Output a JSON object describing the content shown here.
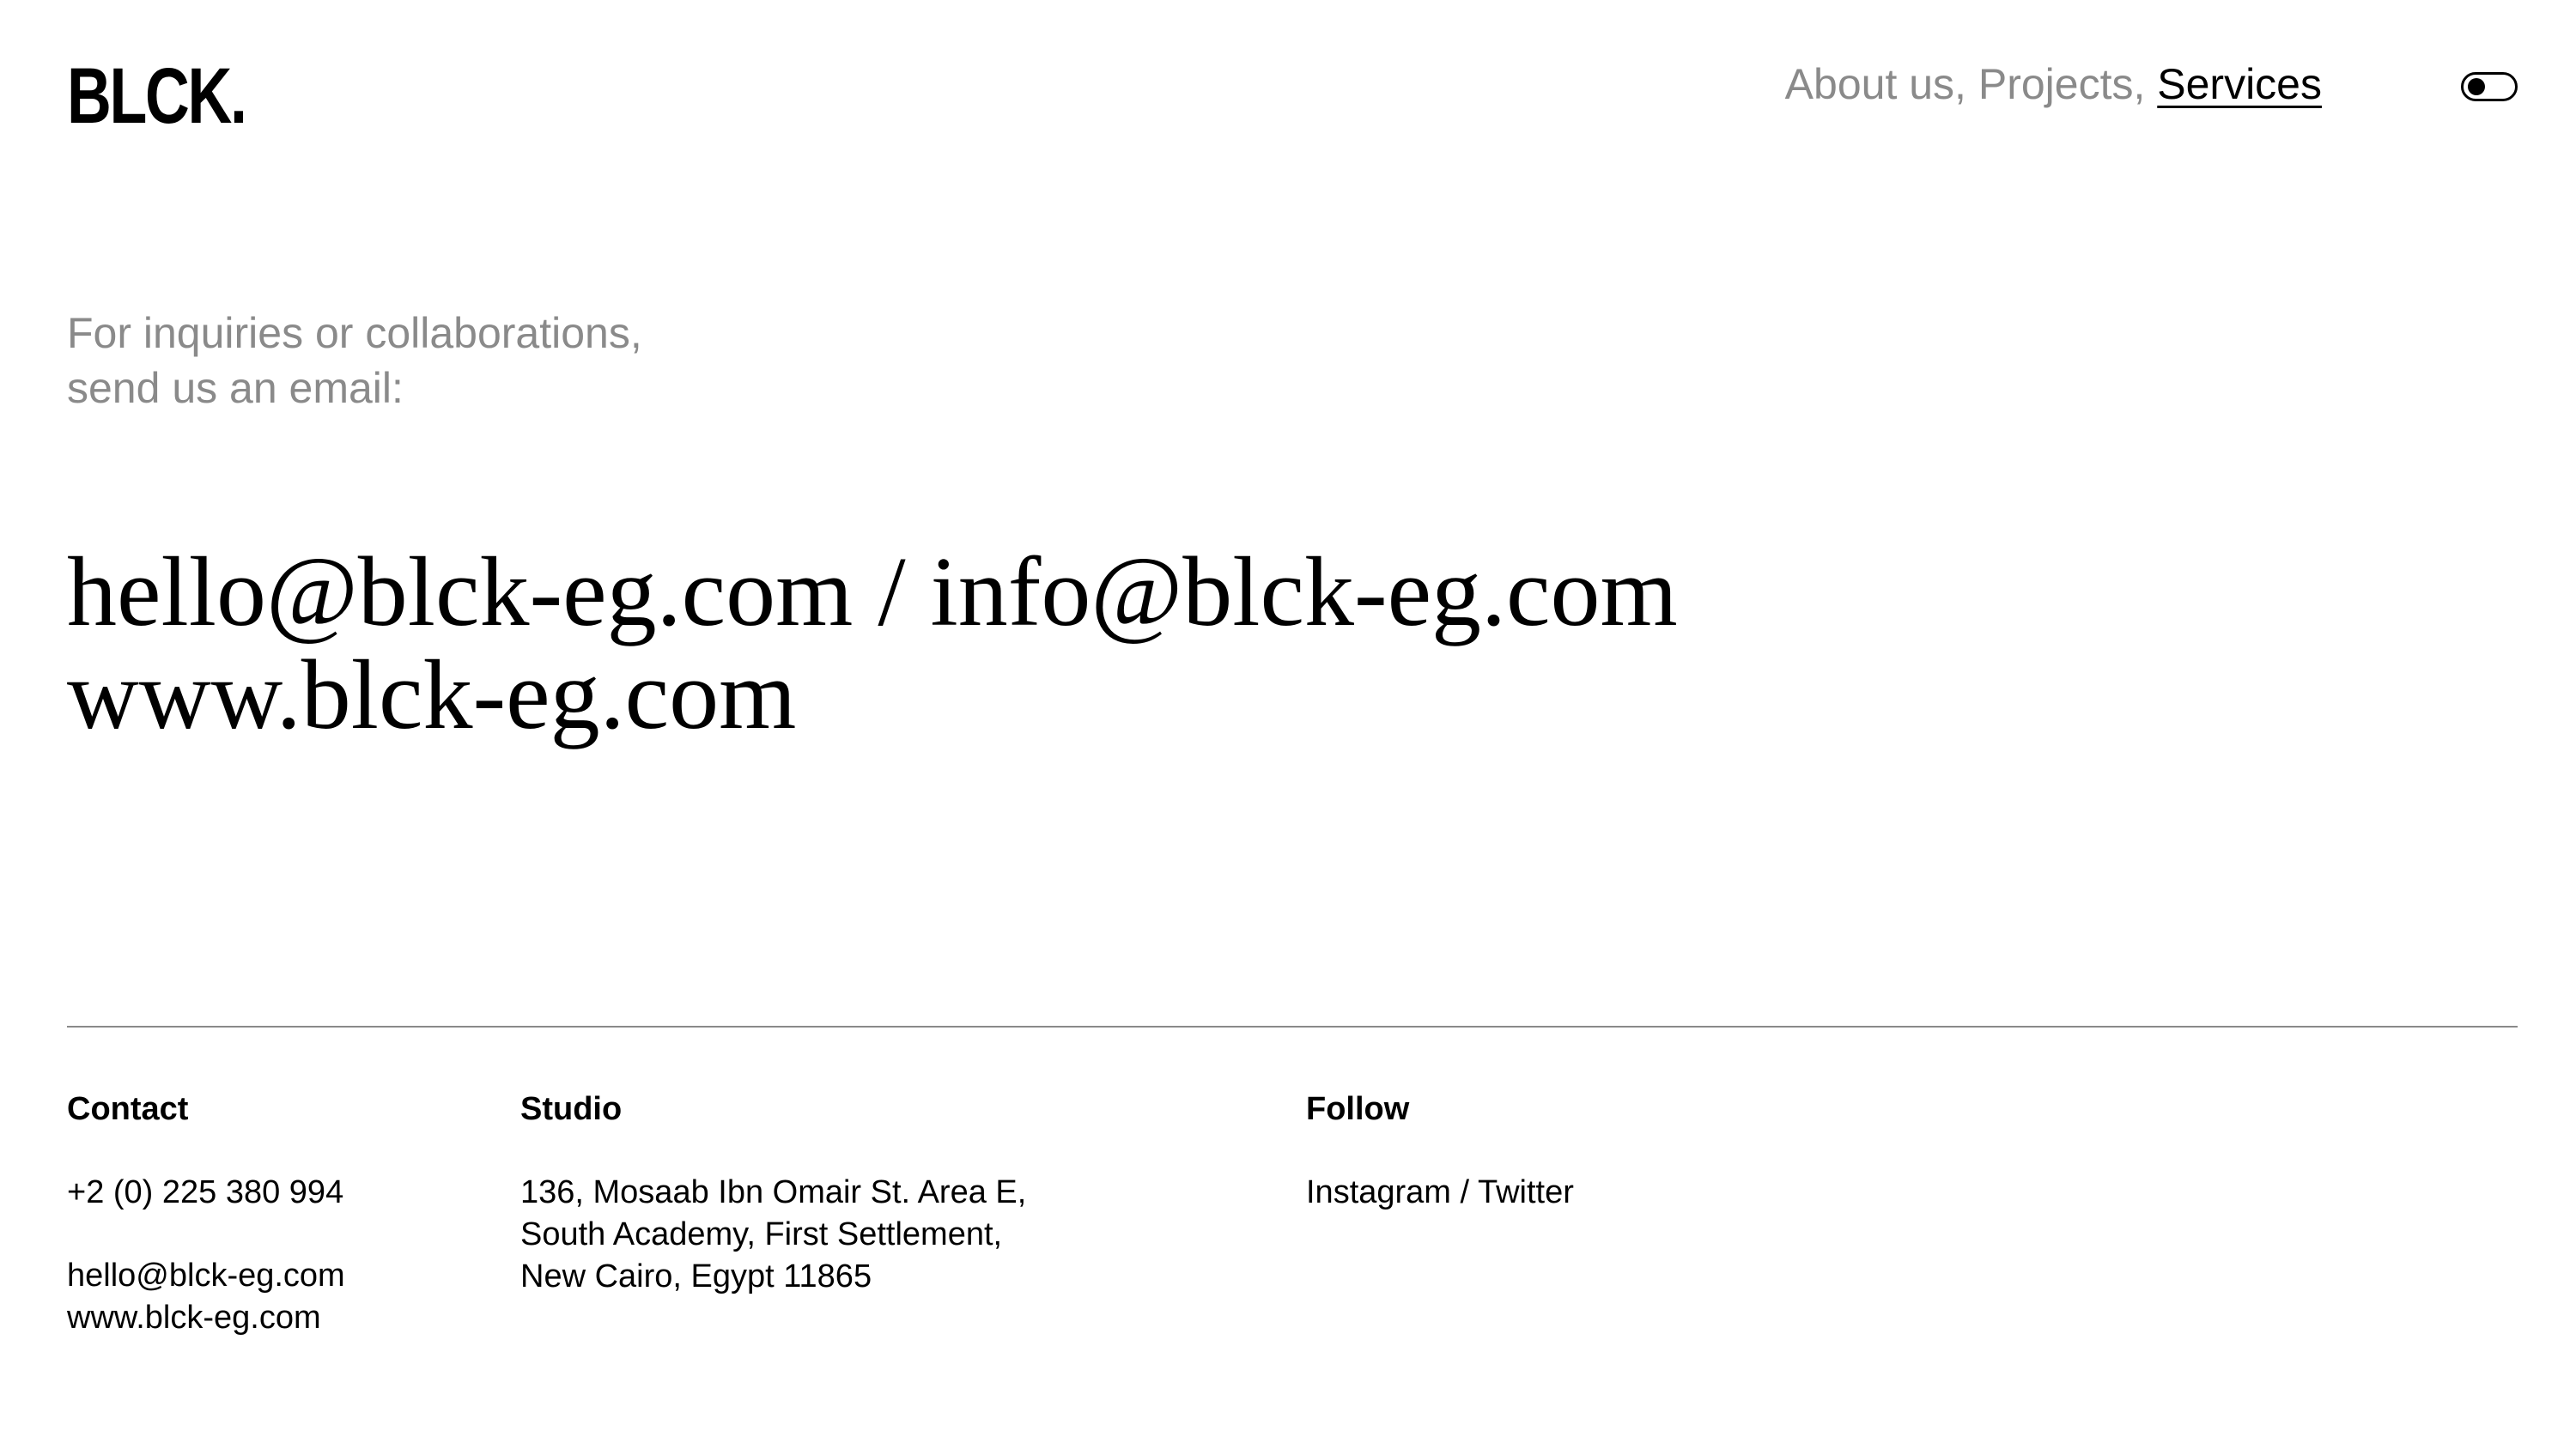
{
  "header": {
    "logo": "BLCK.",
    "nav": {
      "about": "About us,",
      "projects": "Projects,",
      "services": "Services"
    }
  },
  "intro": {
    "line1": "For inquiries or collaborations,",
    "line2": "send us an email:"
  },
  "hero": {
    "email1": "hello@blck-eg.com",
    "separator": "/",
    "email2": "info@blck-eg.com",
    "website": "www.blck-eg.com"
  },
  "footer": {
    "contact": {
      "heading": "Contact",
      "phone": "+2 (0) 225 380 994",
      "email": "hello@blck-eg.com",
      "website": "www.blck-eg.com"
    },
    "studio": {
      "heading": "Studio",
      "address_line1": "136, Mosaab Ibn Omair St. Area E,",
      "address_line2": "South Academy, First Settlement,",
      "address_line3": "New Cairo, Egypt 11865"
    },
    "follow": {
      "heading": "Follow",
      "instagram": "Instagram",
      "separator": "/",
      "twitter": "Twitter"
    }
  },
  "colors": {
    "text": "#000000",
    "muted": "#8a8a8a",
    "background": "#ffffff",
    "divider": "#8a8a8a"
  },
  "icons": {
    "theme_toggle": "toggle-switch-icon"
  }
}
